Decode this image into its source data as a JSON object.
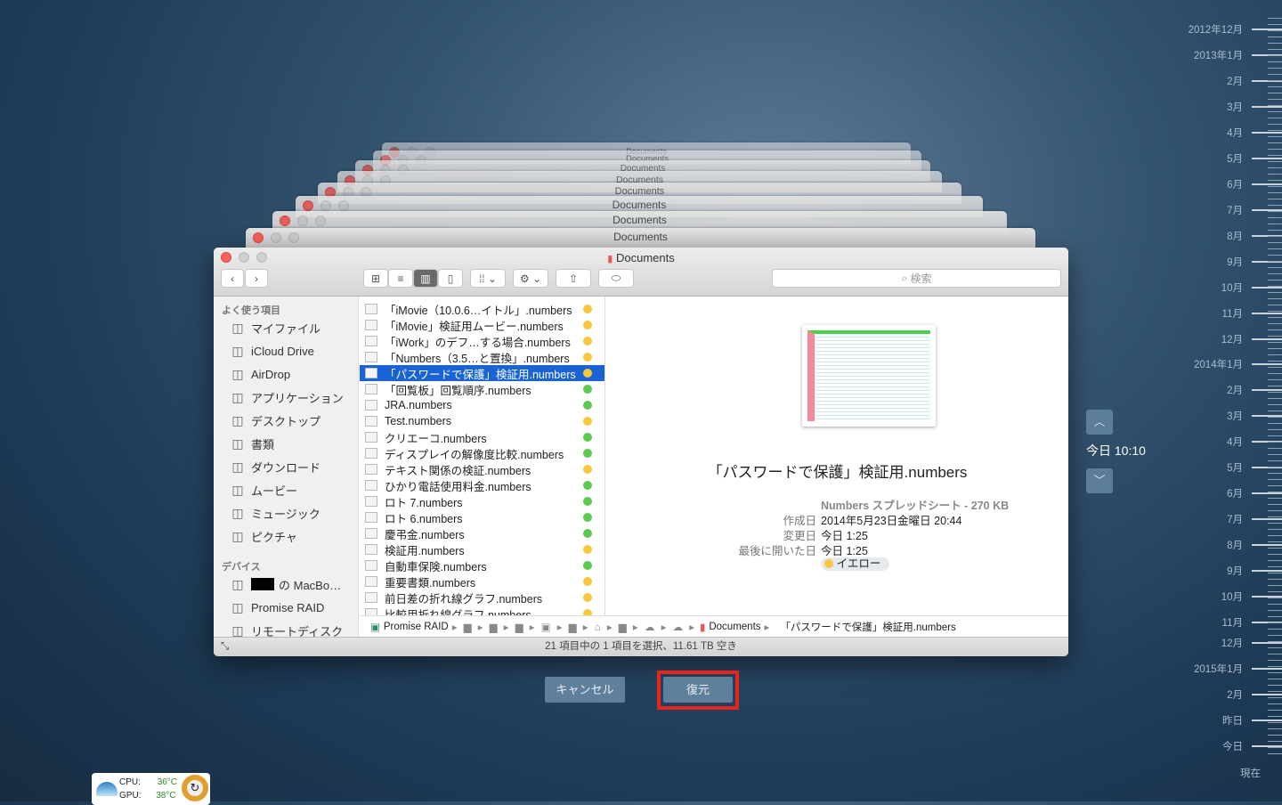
{
  "window": {
    "title": "Documents",
    "search_placeholder": "検索"
  },
  "sidebar": {
    "favorites_header": "よく使う項目",
    "favorites": [
      {
        "label": "マイファイル",
        "icon": "files-icon"
      },
      {
        "label": "iCloud Drive",
        "icon": "cloud-icon"
      },
      {
        "label": "AirDrop",
        "icon": "airdrop-icon"
      },
      {
        "label": "アプリケーション",
        "icon": "apps-icon"
      },
      {
        "label": "デスクトップ",
        "icon": "desktop-icon"
      },
      {
        "label": "書類",
        "icon": "documents-icon"
      },
      {
        "label": "ダウンロード",
        "icon": "download-icon"
      },
      {
        "label": "ムービー",
        "icon": "movie-icon"
      },
      {
        "label": "ミュージック",
        "icon": "music-icon"
      },
      {
        "label": "ピクチャ",
        "icon": "camera-icon"
      }
    ],
    "devices_header": "デバイス",
    "devices": [
      {
        "label": "の MacBo…",
        "icon": "laptop-icon"
      },
      {
        "label": "Promise RAID",
        "icon": "disk-icon"
      },
      {
        "label": "リモートディスク",
        "icon": "disc-icon"
      }
    ]
  },
  "files": [
    {
      "name": "「iMovie（10.0.6…イトル」.numbers",
      "tag": "#f8c63f"
    },
    {
      "name": "「iMovie」検証用ムービー.numbers",
      "tag": "#f8c63f"
    },
    {
      "name": "「iWork」のデフ…する場合.numbers",
      "tag": "#f8c63f"
    },
    {
      "name": "「Numbers（3.5…と置換」.numbers",
      "tag": "#f8c63f"
    },
    {
      "name": "「パスワードで保護」検証用.numbers",
      "tag": "#f8c63f",
      "selected": true
    },
    {
      "name": "「回覧板」回覧順序.numbers",
      "tag": "#5dc94f"
    },
    {
      "name": "JRA.numbers",
      "tag": "#5dc94f"
    },
    {
      "name": "Test.numbers",
      "tag": "#f8c63f"
    },
    {
      "name": "クリエーコ.numbers",
      "tag": "#5dc94f"
    },
    {
      "name": "ディスプレイの解像度比較.numbers",
      "tag": "#5dc94f"
    },
    {
      "name": "テキスト関係の検証.numbers",
      "tag": "#f8c63f"
    },
    {
      "name": "ひかり電話使用料金.numbers",
      "tag": "#5dc94f"
    },
    {
      "name": "ロト 7.numbers",
      "tag": "#5dc94f"
    },
    {
      "name": "ロト 6.numbers",
      "tag": "#5dc94f"
    },
    {
      "name": "慶弔金.numbers",
      "tag": "#5dc94f"
    },
    {
      "name": "検証用.numbers",
      "tag": "#f8c63f"
    },
    {
      "name": "自動車保険.numbers",
      "tag": "#5dc94f"
    },
    {
      "name": "重要書類.numbers",
      "tag": "#f8c63f"
    },
    {
      "name": "前日差の折れ線グラフ.numbers",
      "tag": "#f8c63f"
    },
    {
      "name": "比較用折れ線グラフ.numbers",
      "tag": "#f8c63f"
    }
  ],
  "preview": {
    "filename": "「パスワードで保護」検証用.numbers",
    "kind": "Numbers スプレッドシート - 270 KB",
    "created_label": "作成日",
    "created": "2014年5月23日金曜日 20:44",
    "modified_label": "変更日",
    "modified": "今日 1:25",
    "opened_label": "最後に開いた日",
    "opened": "今日 1:25",
    "tag": "イエロー"
  },
  "path": {
    "root": "Promise RAID",
    "documents": "Documents",
    "file": "「パスワードで保護」検証用.numbers"
  },
  "status": "21 項目中の 1 項目を選択、11.61 TB 空き",
  "time_machine": {
    "cancel": "キャンセル",
    "restore": "復元",
    "current_time": "今日 10:10",
    "timeline": [
      "2012年12月",
      "2013年1月",
      "2月",
      "3月",
      "4月",
      "5月",
      "6月",
      "7月",
      "8月",
      "9月",
      "10月",
      "11月",
      "12月",
      "2014年1月",
      "2月",
      "3月",
      "4月",
      "5月",
      "6月",
      "7月",
      "8月",
      "9月",
      "10月",
      "11月",
      "12月",
      "2015年1月",
      "2月",
      "昨日",
      "今日",
      "現在"
    ]
  },
  "widget": {
    "cpu_label": "CPU:",
    "cpu_temp": "36°C",
    "gpu_label": "GPU:",
    "gpu_temp": "38°C"
  }
}
